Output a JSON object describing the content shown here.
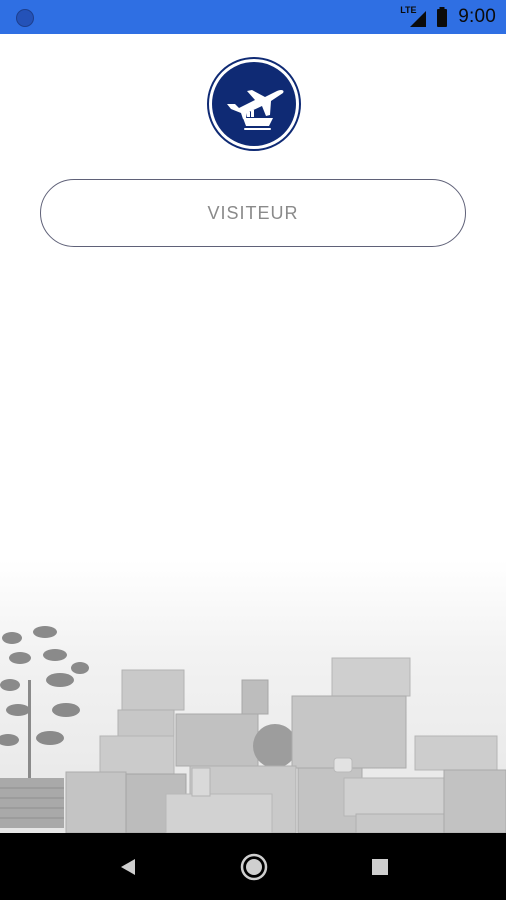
{
  "status_bar": {
    "time": "9:00",
    "network_label": "LTE",
    "icons": [
      "notification-dot-icon",
      "signal-icon",
      "battery-icon"
    ],
    "background_color": "#2f6fe3"
  },
  "app": {
    "logo_icon": "plane-ship-logo-icon",
    "brand_color": "#0f2a74",
    "visitor_button_label": "VISITEUR"
  },
  "background_scene": {
    "description_icon": "moving-boxes-illustration"
  },
  "nav_bar": {
    "icons": [
      "back-icon",
      "home-icon",
      "recents-icon"
    ]
  }
}
